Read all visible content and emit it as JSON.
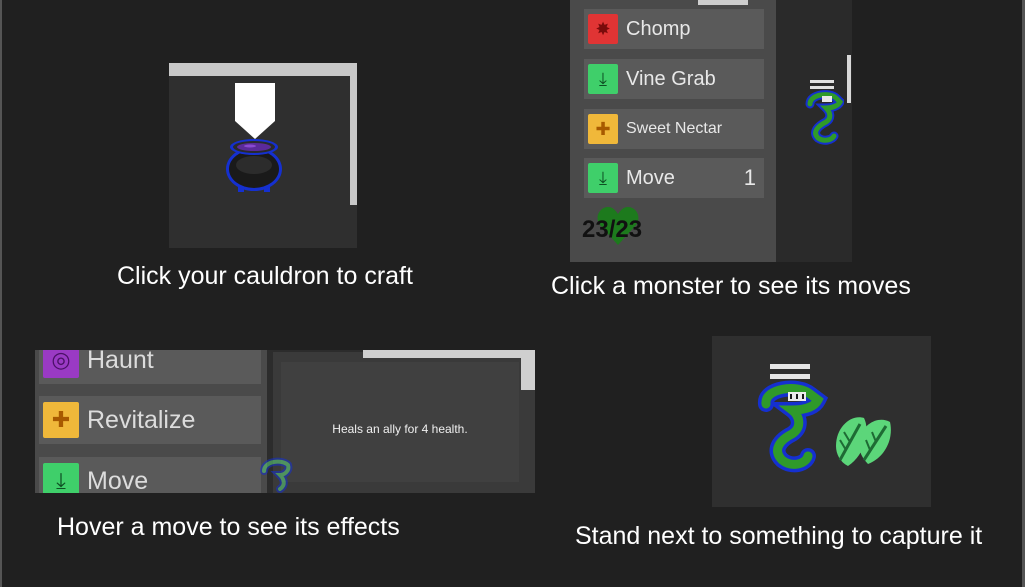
{
  "tutorial": {
    "craft_caption": "Click your cauldron to craft",
    "moves_caption": "Click a monster to see its moves",
    "effects_caption": "Hover a move to see its effects",
    "capture_caption": "Stand next to something to capture it"
  },
  "monster_panel": {
    "moves": [
      {
        "label": "Chomp",
        "icon": "chomp-icon",
        "color": "#e03434"
      },
      {
        "label": "Vine Grab",
        "icon": "vine-grab-icon",
        "color": "#3fcf6a"
      },
      {
        "label": "Sweet Nectar",
        "icon": "sweet-nectar-icon",
        "color": "#f0b83a"
      },
      {
        "label": "Move",
        "icon": "move-icon",
        "color": "#3fcf6a",
        "count": "1"
      }
    ],
    "health": "23/23"
  },
  "effects_panel": {
    "moves": [
      {
        "label": "Haunt",
        "icon": "haunt-icon",
        "color": "#9a3ac4"
      },
      {
        "label": "Revitalize",
        "icon": "revitalize-icon",
        "color": "#f0b83a"
      },
      {
        "label": "Move",
        "icon": "move-icon",
        "color": "#3fcf6a"
      }
    ],
    "tooltip": "Heals an ally for 4 health."
  }
}
